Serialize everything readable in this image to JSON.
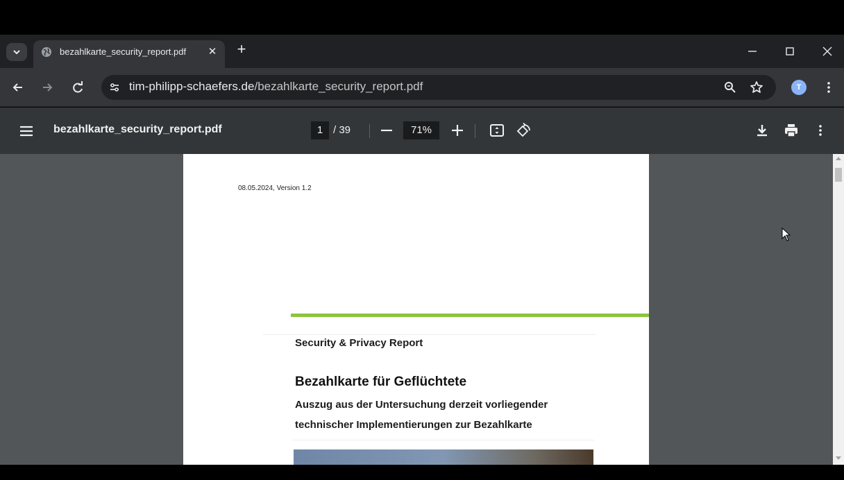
{
  "tab": {
    "title": "bezahlkarte_security_report.pdf",
    "close_glyph": "✕",
    "new_tab_glyph": "+"
  },
  "toolbar": {
    "url_host": "tim-philipp-schaefers.de",
    "url_path": "/bezahlkarte_security_report.pdf",
    "avatar_letter": "T"
  },
  "pdf_toolbar": {
    "file_name": "bezahlkarte_security_report.pdf",
    "current_page": "1",
    "page_total": "/ 39",
    "zoom": "71%"
  },
  "document": {
    "version_line": "08.05.2024, Version 1.2",
    "subtitle": "Security & Privacy Report",
    "title": "Bezahlkarte für Geflüchtete",
    "description_line1": "Auszug aus der Untersuchung derzeit vorliegender",
    "description_line2": "technischer Implementierungen zur Bezahlkarte"
  },
  "icons": {
    "tab_search": "chevron-down-icon",
    "favicon": "globe-icon",
    "back": "arrow-left-icon",
    "forward": "arrow-right-icon",
    "reload": "reload-icon",
    "site_info": "tune-icon",
    "zoom": "zoom-icon",
    "bookmark": "star-icon",
    "menu": "more-vert-icon",
    "pdf_menu": "hamburger-icon",
    "fit": "fit-page-icon",
    "rotate": "rotate-icon",
    "download": "download-icon",
    "print": "print-icon"
  },
  "colors": {
    "accent_green": "#8cc43f",
    "avatar": "#8ab4f8",
    "tabstrip": "#202124",
    "toolbar": "#35363a",
    "pdf_toolbar": "#323639",
    "viewer_bg": "#525659"
  }
}
